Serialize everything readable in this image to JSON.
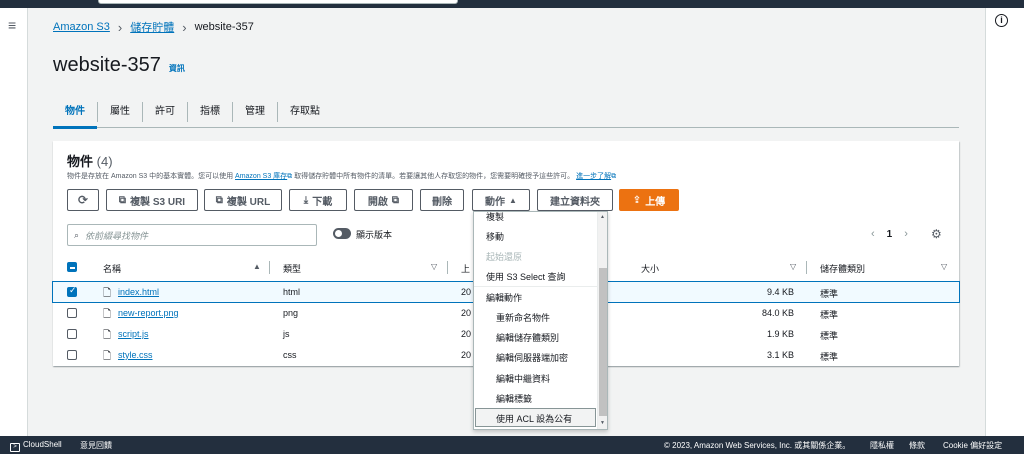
{
  "breadcrumb": {
    "root": "Amazon S3",
    "buckets": "儲存貯體",
    "current": "website-357"
  },
  "page": {
    "title": "website-357",
    "info": "資訊"
  },
  "tabs": [
    "物件",
    "屬性",
    "許可",
    "指標",
    "管理",
    "存取點"
  ],
  "objects_panel": {
    "heading": "物件",
    "count": "(4)",
    "desc_1": "物件是存放在 Amazon S3 中的基本實體。您可以使用",
    "desc_link_1": "Amazon S3 庫存",
    "desc_2": "取得儲存貯體中所有物件的清單。若要讓其他人存取您的物件，您需要明確授予這些許可。",
    "desc_link_2": "進一步了解"
  },
  "toolbar": {
    "refresh": "⟳",
    "copy_s3_uri": "複製 S3 URI",
    "copy_url": "複製 URL",
    "download": "下載",
    "open": "開啟",
    "delete": "刪除",
    "actions": "動作",
    "create_folder": "建立資料夾",
    "upload": "上傳"
  },
  "search": {
    "placeholder": "依前綴尋找物件"
  },
  "versions_toggle": "顯示版本",
  "pagination": {
    "page": "1"
  },
  "table": {
    "headers": {
      "name": "名稱",
      "type": "類型",
      "last_modified": "上",
      "size": "大小",
      "storage_class": "儲存體類別"
    },
    "rows": [
      {
        "name": "index.html",
        "type": "html",
        "modified": "20",
        "size": "9.4 KB",
        "storage": "標準",
        "selected": true
      },
      {
        "name": "new-report.png",
        "type": "png",
        "modified": "20",
        "size": "84.0 KB",
        "storage": "標準",
        "selected": false
      },
      {
        "name": "script.js",
        "type": "js",
        "modified": "20",
        "size": "1.9 KB",
        "storage": "標準",
        "selected": false
      },
      {
        "name": "style.css",
        "type": "css",
        "modified": "20",
        "size": "3.1 KB",
        "storage": "標準",
        "selected": false
      }
    ]
  },
  "actions_menu": {
    "items": [
      {
        "label": "複製",
        "disabled": false
      },
      {
        "label": "移動",
        "disabled": false
      },
      {
        "label": "起始還原",
        "disabled": true
      },
      {
        "label": "使用 S3 Select 查詢",
        "disabled": false
      }
    ],
    "edit_group": "編輯動作",
    "edit_items": [
      "重新命名物件",
      "編輯儲存體類別",
      "編輯伺服器端加密",
      "編輯中繼資料",
      "編輯標籤",
      "使用 ACL 設為公有"
    ]
  },
  "footer": {
    "cloudshell": "CloudShell",
    "feedback": "意見回饋",
    "copyright": "© 2023, Amazon Web Services, Inc. 或其關係企業。",
    "privacy": "隱私權",
    "terms": "條款",
    "cookie": "Cookie 偏好設定"
  },
  "colors": {
    "link": "#0073bb",
    "primary": "#ec7211",
    "dark": "#232f3e"
  }
}
